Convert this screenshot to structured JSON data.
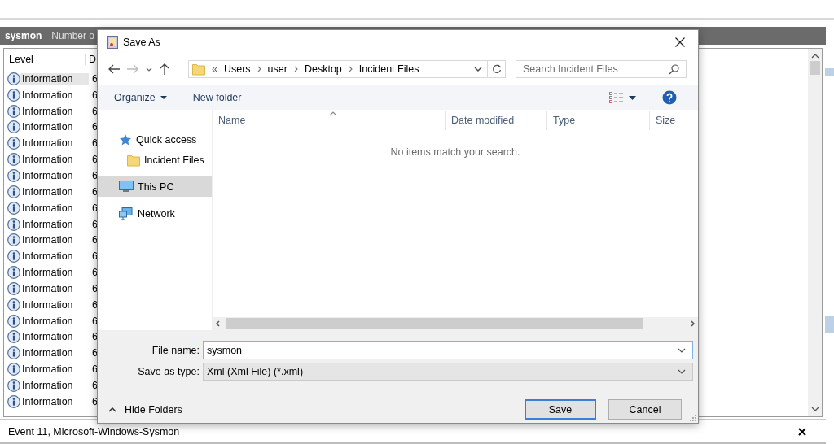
{
  "app": {
    "header": {
      "title": "sysmon",
      "info": "Number o"
    },
    "table": {
      "columns": [
        "Level",
        "D"
      ],
      "rows": [
        {
          "level": "Information",
          "column_2": "6",
          "selected": true
        },
        {
          "level": "Information",
          "column_2": "6",
          "selected": false
        },
        {
          "level": "Information",
          "column_2": "6",
          "selected": false
        },
        {
          "level": "Information",
          "column_2": "6",
          "selected": false
        },
        {
          "level": "Information",
          "column_2": "6",
          "selected": false
        },
        {
          "level": "Information",
          "column_2": "6",
          "selected": false
        },
        {
          "level": "Information",
          "column_2": "6",
          "selected": false
        },
        {
          "level": "Information",
          "column_2": "6",
          "selected": false
        },
        {
          "level": "Information",
          "column_2": "6",
          "selected": false
        },
        {
          "level": "Information",
          "column_2": "6",
          "selected": false
        },
        {
          "level": "Information",
          "column_2": "6",
          "selected": false
        },
        {
          "level": "Information",
          "column_2": "6",
          "selected": false
        },
        {
          "level": "Information",
          "column_2": "6",
          "selected": false
        },
        {
          "level": "Information",
          "column_2": "6",
          "selected": false
        },
        {
          "level": "Information",
          "column_2": "6",
          "selected": false
        },
        {
          "level": "Information",
          "column_2": "6",
          "selected": false
        },
        {
          "level": "Information",
          "column_2": "6",
          "selected": false
        },
        {
          "level": "Information",
          "column_2": "6",
          "selected": false
        },
        {
          "level": "Information",
          "column_2": "6",
          "selected": false
        },
        {
          "level": "Information",
          "column_2": "6",
          "selected": false
        },
        {
          "level": "Information",
          "column_2": "6",
          "selected": false
        }
      ]
    },
    "detail_title": "Event 11, Microsoft-Windows-Sysmon"
  },
  "dialog": {
    "title": "Save As",
    "address": {
      "overflow": "«",
      "crumbs": [
        "Users",
        "user",
        "Desktop",
        "Incident Files"
      ]
    },
    "search": {
      "placeholder": "Search Incident Files"
    },
    "toolbar": [
      {
        "label": "Organize",
        "menu": true
      },
      {
        "label": "New folder",
        "menu": false
      }
    ],
    "nav": [
      {
        "label": "Quick access",
        "kind": "quick",
        "selected": false,
        "children": [
          {
            "label": "Incident Files",
            "kind": "folder",
            "selected": false
          }
        ]
      },
      {
        "label": "This PC",
        "kind": "pc",
        "selected": true
      },
      {
        "label": "Network",
        "kind": "network",
        "selected": false
      }
    ],
    "columns": [
      "Name",
      "Date modified",
      "Type",
      "Size"
    ],
    "empty_message": "No items match your search.",
    "file_name": {
      "label": "File name:",
      "value": "sysmon"
    },
    "save_type": {
      "label": "Save as type:",
      "value": "Xml (Xml File) (*.xml)"
    },
    "hide_folders": "Hide Folders",
    "buttons": [
      {
        "label": "Save",
        "default": true
      },
      {
        "label": "Cancel",
        "default": false
      }
    ]
  }
}
